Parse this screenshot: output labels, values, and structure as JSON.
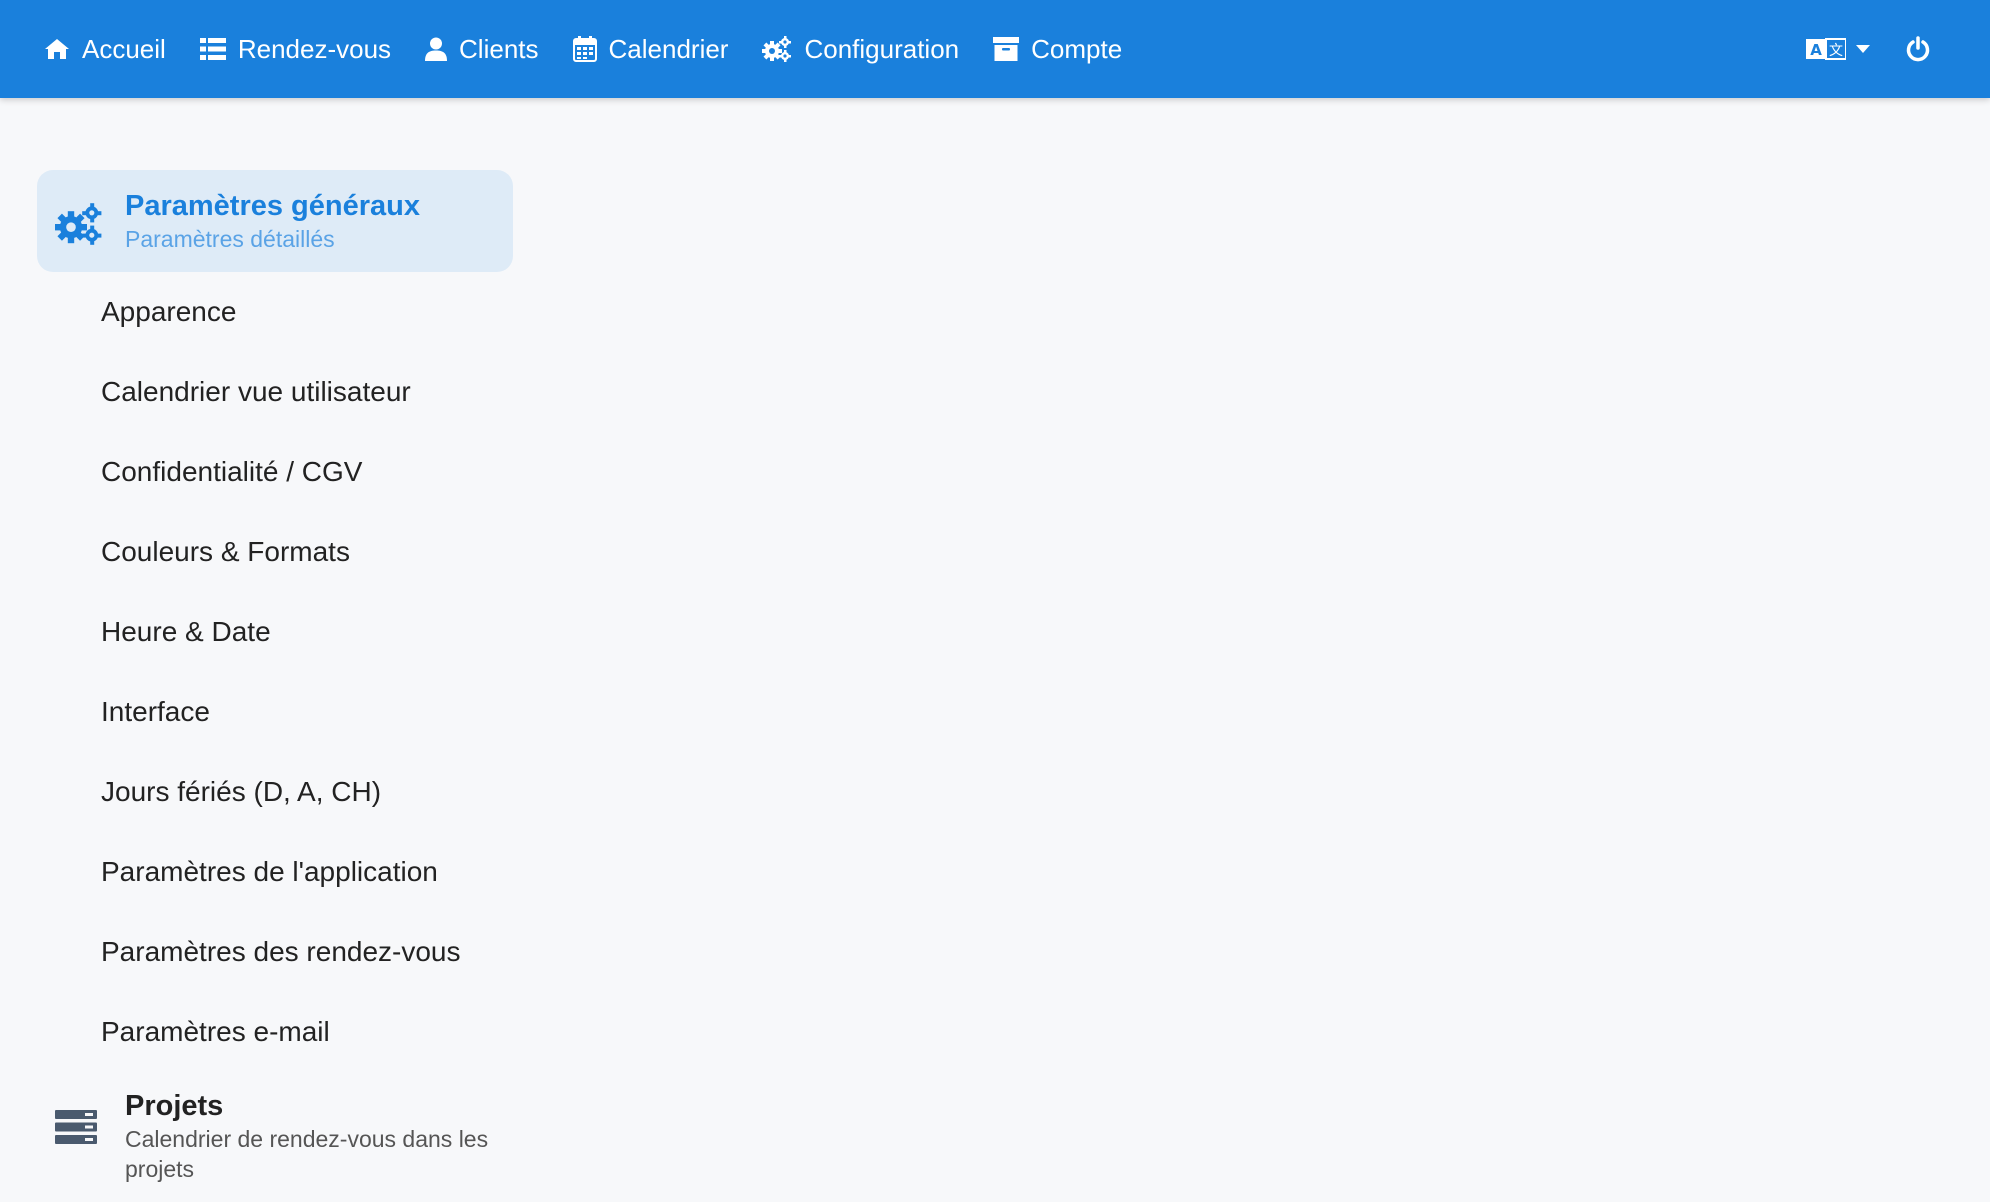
{
  "colors": {
    "topbar": "#1a80dc",
    "accent": "#1a80dc",
    "active_bg": "#deebf7",
    "page_bg": "#f7f8fa"
  },
  "nav": {
    "items": [
      {
        "label": "Accueil",
        "icon": "home-icon"
      },
      {
        "label": "Rendez-vous",
        "icon": "list-icon"
      },
      {
        "label": "Clients",
        "icon": "user-icon"
      },
      {
        "label": "Calendrier",
        "icon": "calendar-icon"
      },
      {
        "label": "Configuration",
        "icon": "cogs-icon"
      },
      {
        "label": "Compte",
        "icon": "archive-icon"
      }
    ],
    "language_icon": "language-icon",
    "power_icon": "power-icon"
  },
  "sidebar": {
    "general": {
      "title": "Paramètres généraux",
      "subtitle": "Paramètres détaillés",
      "icon": "cogs-icon",
      "items": [
        {
          "label": "Apparence"
        },
        {
          "label": "Calendrier vue utilisateur"
        },
        {
          "label": "Confidentialité / CGV"
        },
        {
          "label": "Couleurs & Formats"
        },
        {
          "label": "Heure & Date"
        },
        {
          "label": "Interface"
        },
        {
          "label": "Jours fériés (D, A, CH)"
        },
        {
          "label": "Paramètres de l'application"
        },
        {
          "label": "Paramètres des rendez-vous"
        },
        {
          "label": "Paramètres e-mail"
        }
      ]
    },
    "projects": {
      "title": "Projets",
      "subtitle": "Calendrier de rendez-vous dans les projets",
      "icon": "server-icon"
    }
  }
}
